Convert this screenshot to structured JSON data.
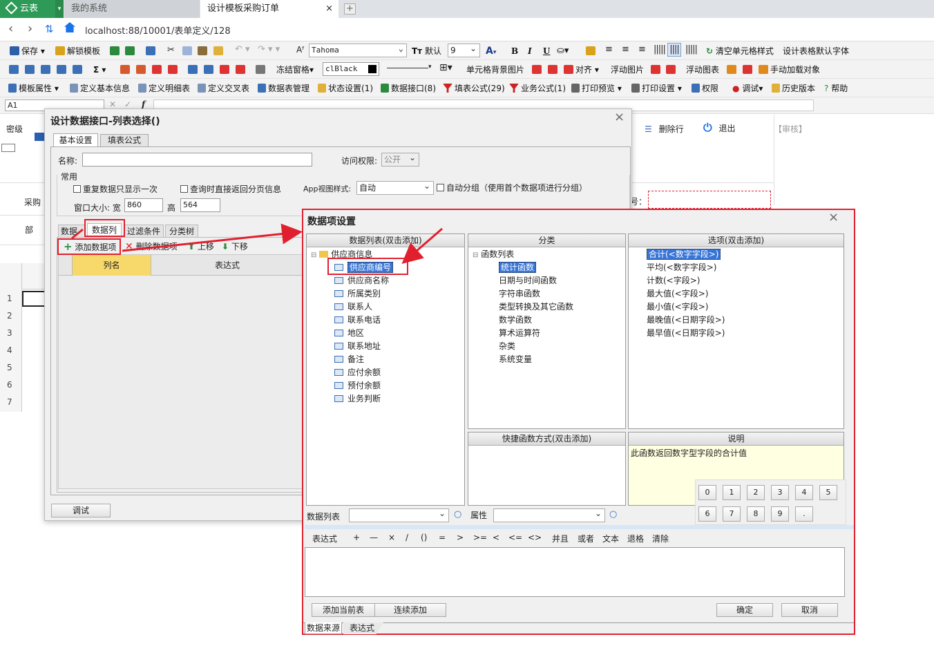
{
  "browser": {
    "tabs": [
      "云表",
      "我的系统",
      "设计模板采购订单"
    ],
    "address": "localhost:88/10001/表单定义/128"
  },
  "toolbar1": {
    "save": "保存",
    "unlock": "解锁模板",
    "font_name": "Tahoma",
    "font_size_label": "默认",
    "font_size": "9",
    "bold": "B",
    "italic": "I",
    "underline": "U",
    "clear_style": "清空单元格样式",
    "default_font": "设计表格默认字体"
  },
  "toolbar2": {
    "sigma": "Σ",
    "freeze": "冻结窗格",
    "color": "clBlack",
    "cell_bg": "单元格背景图片",
    "align": "对齐",
    "float_image": "浮动图片",
    "float_chart": "浮动图表",
    "manual_load": "手动加载对象"
  },
  "toolbar3": {
    "template_props": "模板属性",
    "basic_info": "定义基本信息",
    "detail_table": "定义明细表",
    "cross_table": "定义交叉表",
    "data_mgmt": "数据表管理",
    "state": "状态设置(1)",
    "data_api": "数据接口(8)",
    "fill_formula": "填表公式(29)",
    "biz_formula": "业务公式(1)",
    "print_preview": "打印预览",
    "print_setting": "打印设置",
    "permission": "权限",
    "debug": "调试",
    "history": "历史版本",
    "help": "帮助"
  },
  "formula_bar": {
    "cell_ref": "A1",
    "fx": "f"
  },
  "bg": {
    "label_secret": "密级",
    "delete_row": "删除行",
    "exit": "退出",
    "review": "【审核】",
    "label_purchase": "采购",
    "label_dept": "部",
    "label_colon": "号：",
    "row_numbers": [
      "1",
      "2",
      "3",
      "4",
      "5",
      "6",
      "7"
    ]
  },
  "dialog1": {
    "title": "设计数据接口-列表选择()",
    "tabs": [
      "基本设置",
      "填表公式"
    ],
    "name_label": "名称:",
    "access_label": "访问权限:",
    "access_value": "公开",
    "group_label": "常用",
    "opt_repeat": "重复数据只显示一次",
    "opt_paging": "查询时直接返回分页信息",
    "app_view_label": "App视图样式:",
    "app_view_value": "自动",
    "auto_group": "自动分组（使用首个数据项进行分组）",
    "window_size_label": "窗口大小: 宽",
    "width": "860",
    "height_label": "高",
    "height": "564",
    "subtabs": [
      "数据源",
      "数据列",
      "过滤条件",
      "分类树"
    ],
    "add_item": "添加数据项",
    "delete_item": "删除数据项",
    "move_up": "上移",
    "move_down": "下移",
    "col_name": "列名",
    "col_expr": "表达式",
    "debug_btn": "调试"
  },
  "dialog2": {
    "title": "数据项设置",
    "panel_list_title": "数据列表(双击添加)",
    "tree_root": "供应商信息",
    "tree_items": [
      "供应商编号",
      "供应商名称",
      "所属类别",
      "联系人",
      "联系电话",
      "地区",
      "联系地址",
      "备注",
      "应付余额",
      "预付余额",
      "业务判断"
    ],
    "panel_cat_title": "分类",
    "cat_root": "函数列表",
    "cat_items": [
      "统计函数",
      "日期与时间函数",
      "字符串函数",
      "类型转换及其它函数",
      "数学函数",
      "算术运算符",
      "杂类",
      "系统变量"
    ],
    "panel_opt_title": "选项(双击添加)",
    "opt_items": [
      "合计(<数字字段>)",
      "平均(<数字字段>)",
      "计数(<字段>)",
      "最大值(<字段>)",
      "最小值(<字段>)",
      "最晚值(<日期字段>)",
      "最早值(<日期字段>)"
    ],
    "panel_quick_title": "快捷函数方式(双击添加)",
    "panel_desc_title": "说明",
    "desc_text": "此函数返回数字型字段的合计值",
    "keypad": [
      "0",
      "1",
      "2",
      "3",
      "4",
      "5",
      "6",
      "7",
      "8",
      "9",
      "."
    ],
    "list_label": "数据列表",
    "attr_label": "属性",
    "expr_label": "表达式",
    "operators": [
      "+",
      "—",
      "×",
      "/",
      "()",
      "=",
      ">",
      ">=",
      "<",
      "<=",
      "<>",
      "并且",
      "或者",
      "文本",
      "退格",
      "清除"
    ],
    "btn_add_current": "添加当前表",
    "btn_add_continue": "连续添加",
    "btn_ok": "确定",
    "btn_cancel": "取消",
    "bottom_tabs": [
      "数据来源",
      "表达式"
    ]
  }
}
